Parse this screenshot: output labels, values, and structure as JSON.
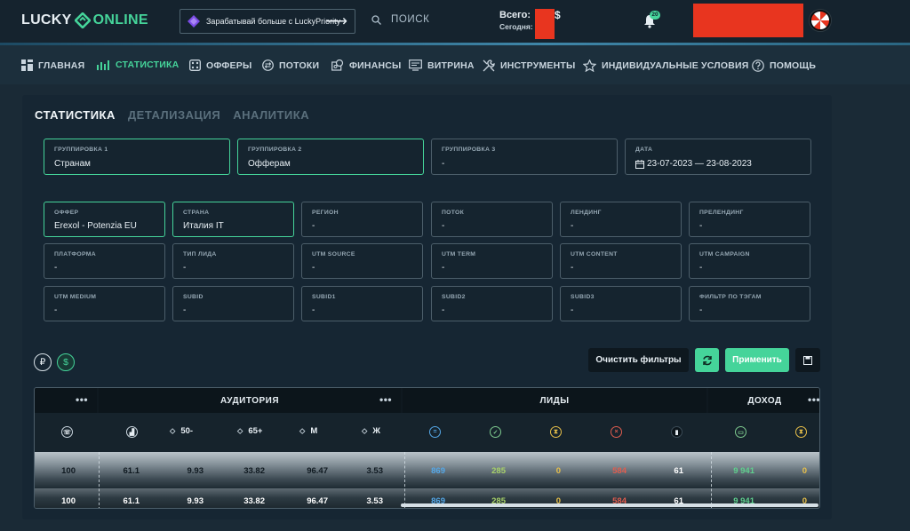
{
  "header": {
    "logo_part1": "LUCKY",
    "logo_part2": "ONLINE",
    "promo_text": "Зарабатывай больше с LuckyPriority",
    "search_label": "ПОИСК",
    "total_label": "Всего:",
    "today_label": "Сегодня:",
    "currency_suffix": "$",
    "notifications_count": "20"
  },
  "nav": [
    {
      "label": "ГЛАВНАЯ",
      "icon": "grid-icon"
    },
    {
      "label": "СТАТИСТИКА",
      "icon": "bar-chart-icon"
    },
    {
      "label": "ОФФЕРЫ",
      "icon": "offers-icon"
    },
    {
      "label": "ПОТОКИ",
      "icon": "streams-icon"
    },
    {
      "label": "ФИНАНСЫ",
      "icon": "finance-icon"
    },
    {
      "label": "ВИТРИНА",
      "icon": "showcase-icon"
    },
    {
      "label": "ИНСТРУМЕНТЫ",
      "icon": "tools-icon"
    },
    {
      "label": "ИНДИВИДУАЛЬНЫЕ УСЛОВИЯ",
      "icon": "star-icon"
    },
    {
      "label": "ПОМОЩЬ",
      "icon": "help-icon"
    }
  ],
  "tabs": [
    "СТАТИСТИКА",
    "ДЕТАЛИЗАЦИЯ",
    "АНАЛИТИКА"
  ],
  "grouping": [
    {
      "label": "ГРУППИРОВКА 1",
      "value": "Странам"
    },
    {
      "label": "ГРУППИРОВКА 2",
      "value": "Офферам"
    },
    {
      "label": "ГРУППИРОВКА 3",
      "value": "-"
    },
    {
      "label": "ДАТА",
      "value": "23-07-2023 — 23-08-2023"
    }
  ],
  "filters": [
    {
      "label": "ОФФЕР",
      "value": "Erexol - Potenzia EU"
    },
    {
      "label": "СТРАНА",
      "value": "Италия IT"
    },
    {
      "label": "РЕГИОН",
      "value": "-"
    },
    {
      "label": "ПОТОК",
      "value": "-"
    },
    {
      "label": "ЛЕНДИНГ",
      "value": "-"
    },
    {
      "label": "ПРЕЛЕНДИНГ",
      "value": "-"
    },
    {
      "label": "ПЛАТФОРМА",
      "value": "-"
    },
    {
      "label": "ТИП ЛИДА",
      "value": "-"
    },
    {
      "label": "UTM SOURCE",
      "value": "-"
    },
    {
      "label": "UTM TERM",
      "value": "-"
    },
    {
      "label": "UTM CONTENT",
      "value": "-"
    },
    {
      "label": "UTM CAMPAIGN",
      "value": "-"
    },
    {
      "label": "UTM MEDIUM",
      "value": "-"
    },
    {
      "label": "SUBID",
      "value": "-"
    },
    {
      "label": "SUBID1",
      "value": "-"
    },
    {
      "label": "SUBID2",
      "value": "-"
    },
    {
      "label": "SUBID3",
      "value": "-"
    },
    {
      "label": "ФИЛЬТР ПО ТЭГАМ",
      "value": "-"
    }
  ],
  "currency": {
    "rub": "₽",
    "usd": "$"
  },
  "actions": {
    "clear": "Очистить фильтры",
    "apply": "Применить"
  },
  "table": {
    "groups": {
      "audience": "АУДИТОРИЯ",
      "leads": "ЛИДЫ",
      "income": "ДОХОД"
    },
    "dots": "•••",
    "headers": {
      "age1": "50-",
      "age2": "65+",
      "male": "М",
      "female": "Ж"
    },
    "rows": [
      [
        "100",
        "61.1",
        "9.93",
        "33.82",
        "96.47",
        "3.53",
        "869",
        "285",
        "0",
        "584",
        "61",
        "9 941",
        "0"
      ],
      [
        "100",
        "61.1",
        "9.93",
        "33.82",
        "96.47",
        "3.53",
        "869",
        "285",
        "0",
        "584",
        "61",
        "9 941",
        "0"
      ]
    ]
  },
  "colors": {
    "accent": "#45d49a",
    "blue": "#55a8e8",
    "yellow": "#e8c04a",
    "red": "#e05d4f"
  }
}
